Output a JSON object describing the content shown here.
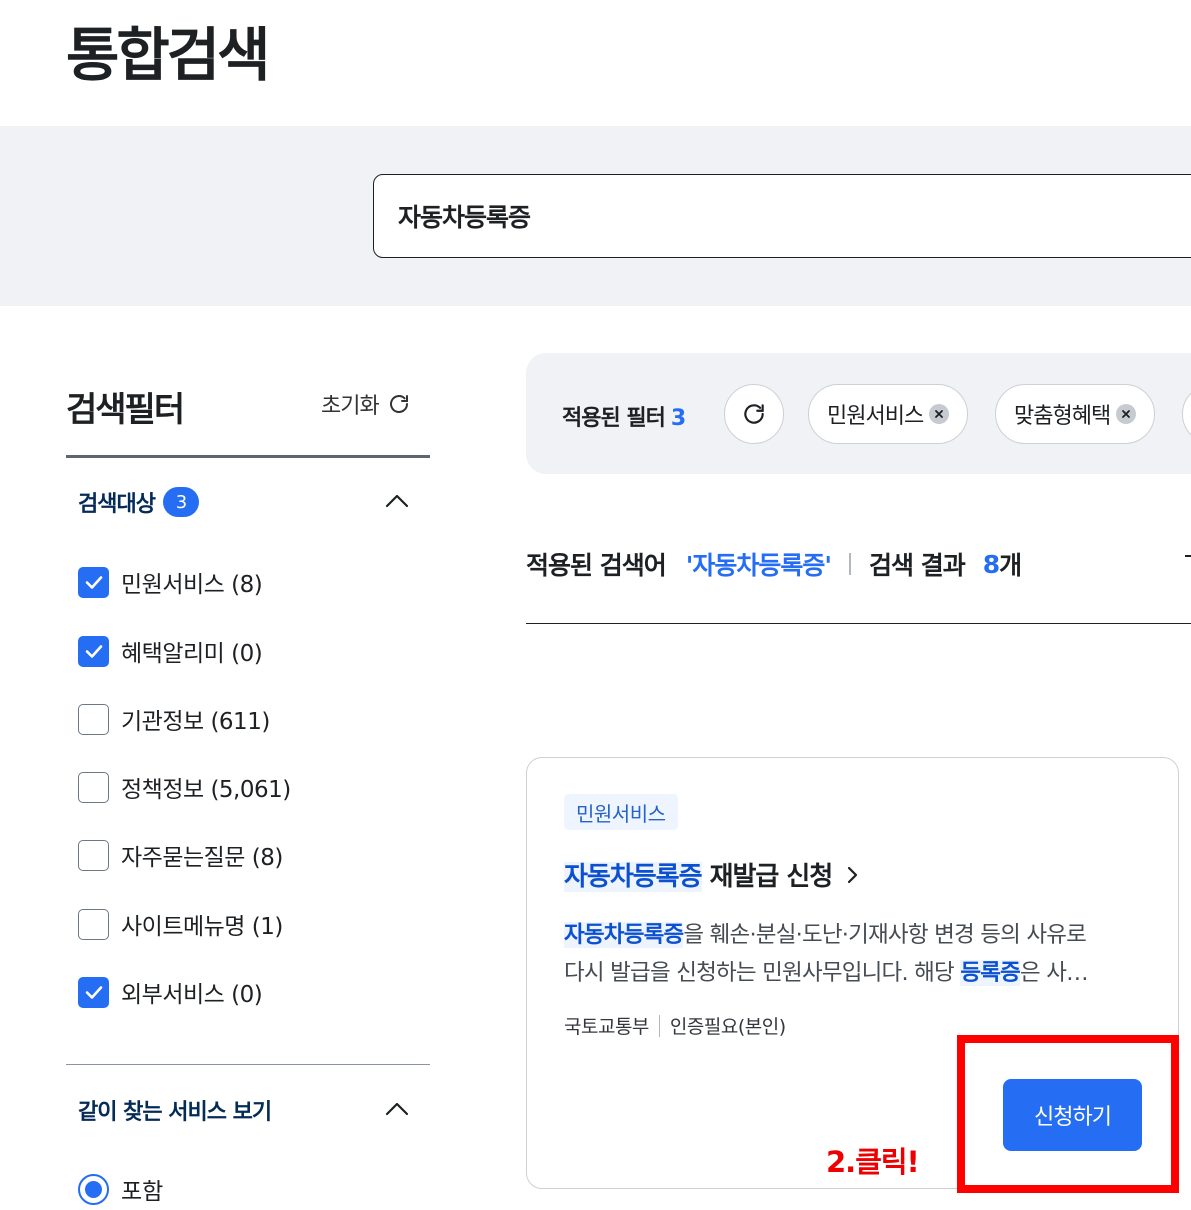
{
  "page_title": "통합검색",
  "search": {
    "value": "자동차등록증"
  },
  "filter_panel": {
    "title": "검색필터",
    "reset_label": "초기화",
    "target_section": {
      "title": "검색대상",
      "count": "3",
      "options": [
        {
          "label": "민원서비스 (8)",
          "checked": true
        },
        {
          "label": "혜택알리미 (0)",
          "checked": true
        },
        {
          "label": "기관정보 (611)",
          "checked": false
        },
        {
          "label": "정책정보 (5,061)",
          "checked": false
        },
        {
          "label": "자주묻는질문 (8)",
          "checked": false
        },
        {
          "label": "사이트메뉴명 (1)",
          "checked": false
        },
        {
          "label": "외부서비스 (0)",
          "checked": true
        }
      ]
    },
    "together_section": {
      "title": "같이 찾는 서비스 보기",
      "radio_label": "포함"
    }
  },
  "applied_filters": {
    "label": "적용된 필터",
    "count": "3",
    "chips": [
      "민원서비스",
      "맞춤형혜택"
    ]
  },
  "summary": {
    "prefix": "적용된 검색어",
    "keyword": "'자동차등록증'",
    "result_label": "검색 결과",
    "result_count": "8",
    "result_unit": "개"
  },
  "result_card": {
    "tag": "민원서비스",
    "title_highlight": "자동차등록증",
    "title_rest": "재발급 신청",
    "desc_line1_hl": "자동차등록증",
    "desc_line1_rest": "을 훼손·분실·도난·기재사항 변경 등의 사유로",
    "desc_line2_pre": "다시 발급을 신청하는 민원사무입니다. 해당 ",
    "desc_line2_hl": "등록증",
    "desc_line2_rest": "은 사…",
    "meta_org": "국토교통부",
    "meta_auth": "인증필요(본인)",
    "button_label": "신청하기"
  },
  "annotation": {
    "text": "2.클릭!",
    "color": "#ff0000"
  },
  "colors": {
    "primary": "#256ef4",
    "highlight_text": "#0b50d0",
    "band_bg": "#f0f2f5"
  }
}
